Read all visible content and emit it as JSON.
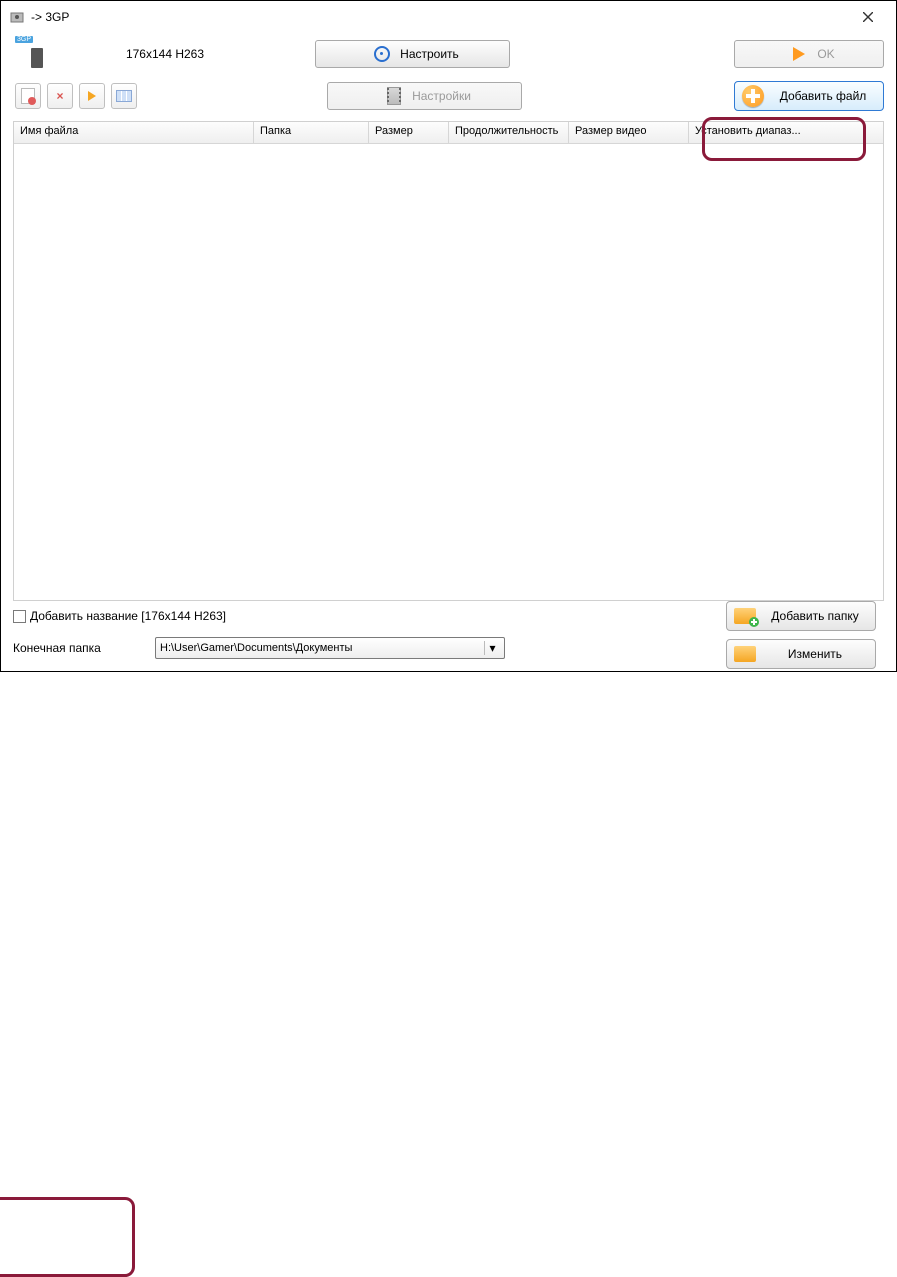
{
  "titlebar": {
    "title": " -> 3GP"
  },
  "toolbar": {
    "format_badge": "3GP",
    "format_label": "176x144 H263",
    "configure_label": "Настроить",
    "settings_label": "Настройки",
    "ok_label": "OK",
    "add_file_label": "Добавить файл"
  },
  "table": {
    "columns": [
      "Имя файла",
      "Папка",
      "Размер",
      "Продолжительность",
      "Размер видео",
      "Установить диапаз..."
    ],
    "rows": []
  },
  "bottom": {
    "add_name_label": "Добавить название [176x144 H263]",
    "dest_label": "Конечная папка",
    "dest_value": "H:\\User\\Gamer\\Documents\\Документы",
    "add_folder_label": "Добавить папку",
    "change_label": "Изменить"
  }
}
